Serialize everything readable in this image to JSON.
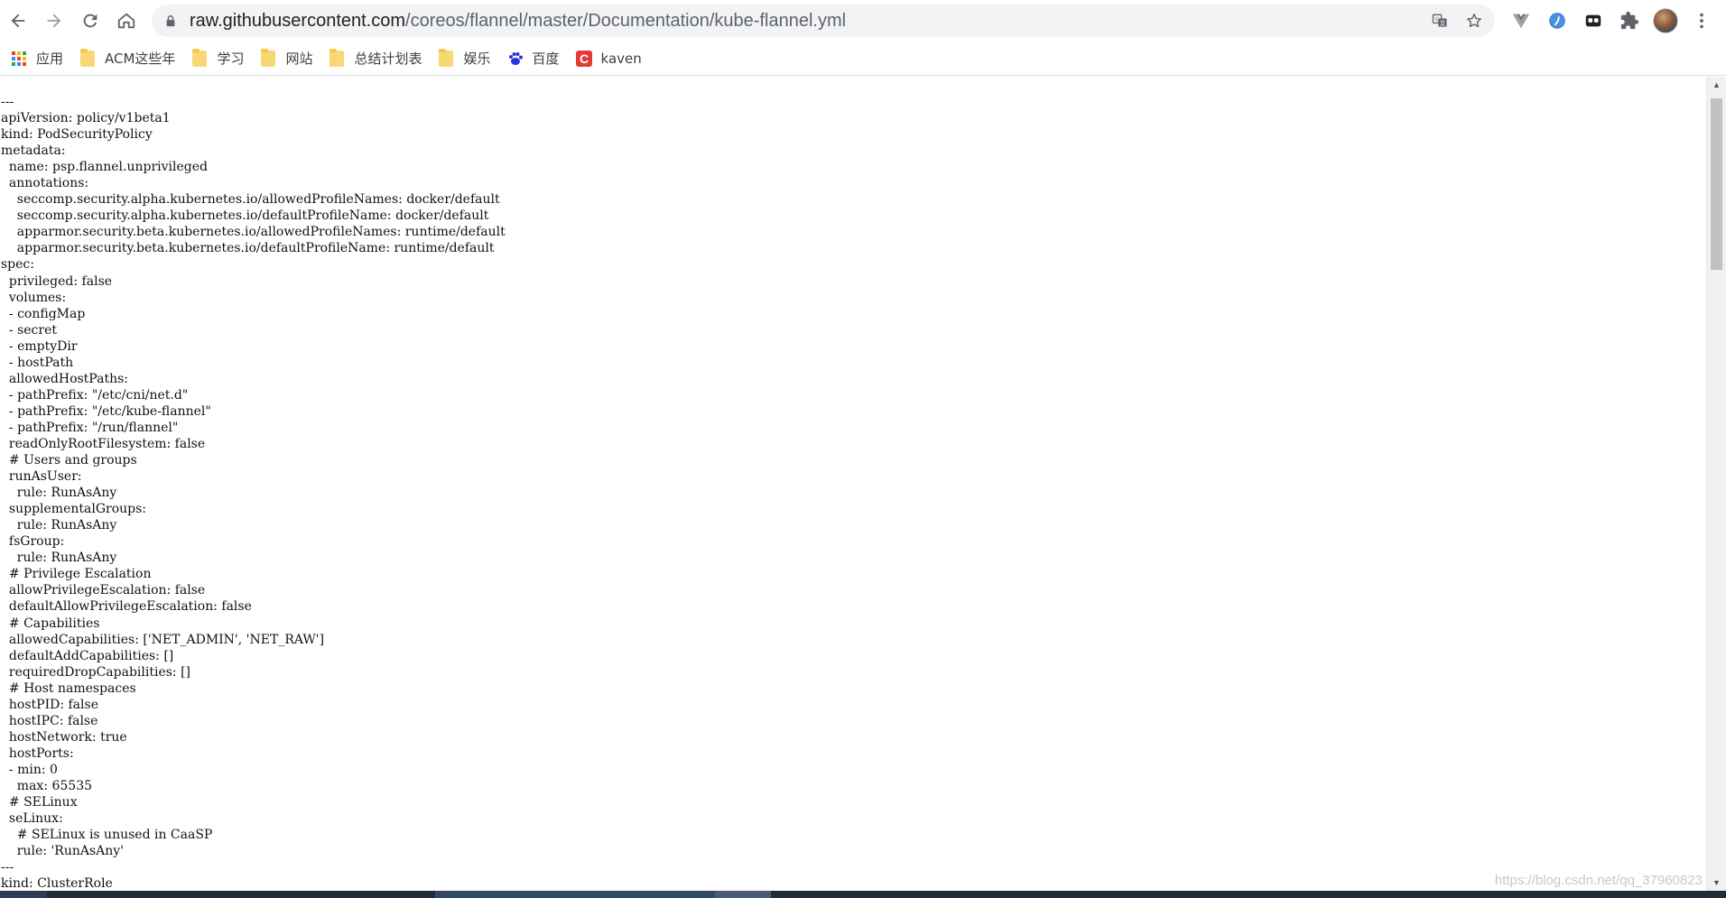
{
  "browser": {
    "url_host": "raw.githubusercontent.com",
    "url_path": "/coreos/flannel/master/Documentation/kube-flannel.yml",
    "icons": {
      "back": "arrow-left-icon",
      "forward": "arrow-right-icon",
      "reload": "reload-icon",
      "home": "home-icon",
      "lock": "lock-icon",
      "translate": "translate-icon",
      "bookmark_star": "star-icon",
      "extensions": "puzzle-icon"
    }
  },
  "bookmarks": [
    {
      "label": "应用",
      "icon": "apps-grid-icon"
    },
    {
      "label": "ACM这些年",
      "icon": "folder-icon"
    },
    {
      "label": "学习",
      "icon": "folder-icon"
    },
    {
      "label": "网站",
      "icon": "folder-icon"
    },
    {
      "label": "总结计划表",
      "icon": "folder-icon"
    },
    {
      "label": "娱乐",
      "icon": "folder-icon"
    },
    {
      "label": "百度",
      "icon": "baidu-paw-icon"
    },
    {
      "label": "kaven",
      "icon": "csdn-icon"
    }
  ],
  "document": {
    "lines": [
      "---",
      "apiVersion: policy/v1beta1",
      "kind: PodSecurityPolicy",
      "metadata:",
      "  name: psp.flannel.unprivileged",
      "  annotations:",
      "    seccomp.security.alpha.kubernetes.io/allowedProfileNames: docker/default",
      "    seccomp.security.alpha.kubernetes.io/defaultProfileName: docker/default",
      "    apparmor.security.beta.kubernetes.io/allowedProfileNames: runtime/default",
      "    apparmor.security.beta.kubernetes.io/defaultProfileName: runtime/default",
      "spec:",
      "  privileged: false",
      "  volumes:",
      "  - configMap",
      "  - secret",
      "  - emptyDir",
      "  - hostPath",
      "  allowedHostPaths:",
      "  - pathPrefix: \"/etc/cni/net.d\"",
      "  - pathPrefix: \"/etc/kube-flannel\"",
      "  - pathPrefix: \"/run/flannel\"",
      "  readOnlyRootFilesystem: false",
      "  # Users and groups",
      "  runAsUser:",
      "    rule: RunAsAny",
      "  supplementalGroups:",
      "    rule: RunAsAny",
      "  fsGroup:",
      "    rule: RunAsAny",
      "  # Privilege Escalation",
      "  allowPrivilegeEscalation: false",
      "  defaultAllowPrivilegeEscalation: false",
      "  # Capabilities",
      "  allowedCapabilities: ['NET_ADMIN', 'NET_RAW']",
      "  defaultAddCapabilities: []",
      "  requiredDropCapabilities: []",
      "  # Host namespaces",
      "  hostPID: false",
      "  hostIPC: false",
      "  hostNetwork: true",
      "  hostPorts:",
      "  - min: 0",
      "    max: 65535",
      "  # SELinux",
      "  seLinux:",
      "    # SELinux is unused in CaaSP",
      "    rule: 'RunAsAny'",
      "---",
      "kind: ClusterRole"
    ]
  },
  "watermark": "https://blog.csdn.net/qq_37960823"
}
